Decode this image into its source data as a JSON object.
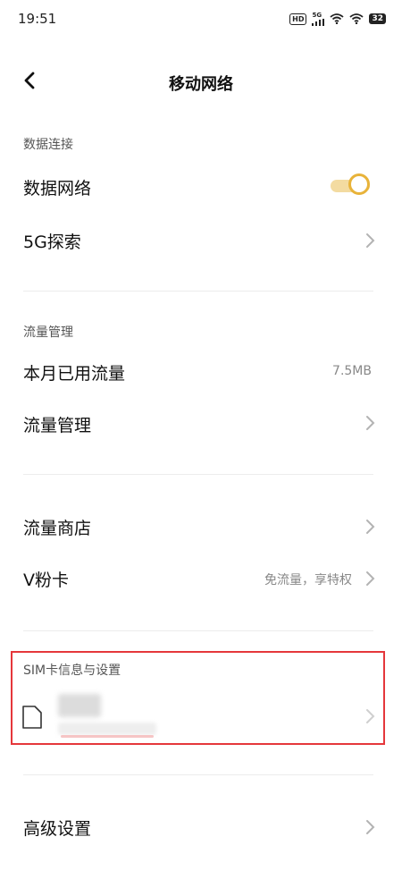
{
  "status_bar": {
    "time": "19:51",
    "hd": "HD",
    "network": "5G",
    "battery": "32"
  },
  "header": {
    "title": "移动网络"
  },
  "data_connection": {
    "section_label": "数据连接",
    "data_network_label": "数据网络",
    "data_network_on": true,
    "explore_5g_label": "5G探索"
  },
  "traffic": {
    "section_label": "流量管理",
    "monthly_used_label": "本月已用流量",
    "monthly_used_value": "7.5MB",
    "traffic_manage_label": "流量管理"
  },
  "store": {
    "traffic_store_label": "流量商店",
    "vcard_label": "V粉卡",
    "vcard_value": "免流量，享特权"
  },
  "sim": {
    "section_label": "SIM卡信息与设置"
  },
  "advanced": {
    "label": "高级设置"
  },
  "colors": {
    "accent": "#e8b33a",
    "track": "#f3dba1",
    "highlight": "#e5373b"
  }
}
